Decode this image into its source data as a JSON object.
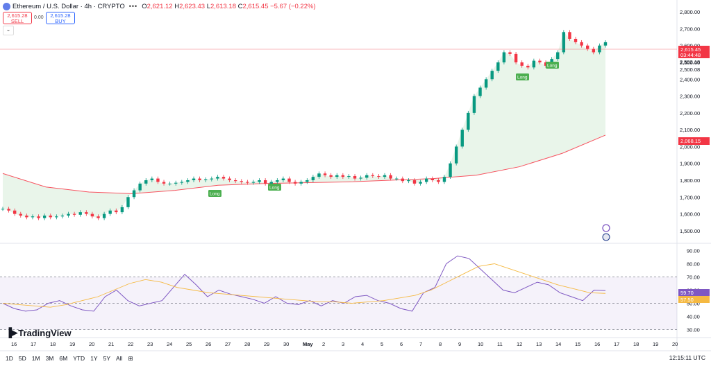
{
  "header": {
    "symbol": "Ethereum / U.S. Dollar · 4h · CRYPTO",
    "o_label": "O",
    "o_value": "2,621.12",
    "h_label": "H",
    "h_value": "2,623.43",
    "l_label": "L",
    "l_value": "2,613.18",
    "c_label": "C",
    "c_value": "2,615.45",
    "change": "−5.67 (−0.22%)"
  },
  "trade": {
    "sell_price": "2,615.28",
    "sell_label": "SELL",
    "spread": "0.00",
    "buy_price": "2,615.28",
    "buy_label": "BUY"
  },
  "price_axis": {
    "ticks": [
      "2,800.00",
      "2,700.00",
      "2,600.00",
      "2,500.00",
      "2,400.00",
      "2,300.00",
      "2,200.00",
      "2,100.00",
      "2,000.00",
      "1,900.00",
      "1,800.00",
      "1,700.00",
      "1,600.00",
      "1,500.00"
    ],
    "current_price": "2,615.45",
    "countdown": "03:44:48",
    "level_1": "2,593.18",
    "level_2": "2,500.08",
    "ma_price": "2,068.15"
  },
  "rsi_axis": {
    "ticks": [
      "90.00",
      "80.00",
      "70.00",
      "60.00",
      "50.00",
      "40.00",
      "30.00"
    ],
    "rsi_value": "59.70",
    "rsi_ma_value": "57.50"
  },
  "time_axis": {
    "labels": [
      "16",
      "17",
      "18",
      "19",
      "20",
      "21",
      "22",
      "23",
      "24",
      "25",
      "26",
      "27",
      "28",
      "29",
      "30",
      "May",
      "2",
      "3",
      "4",
      "5",
      "6",
      "7",
      "8",
      "9",
      "10",
      "11",
      "12",
      "13",
      "14",
      "15",
      "16",
      "17",
      "18",
      "19",
      "20"
    ]
  },
  "signals": [
    "Long",
    "Long",
    "Long",
    "Long"
  ],
  "brand": "TradingView",
  "timeframes": [
    "1D",
    "5D",
    "1M",
    "3M",
    "6M",
    "YTD",
    "1Y",
    "5Y",
    "All"
  ],
  "clock": "12:15:11 UTC",
  "colors": {
    "up": "#089981",
    "down": "#f23645",
    "ma": "#f7525f",
    "rsi": "#7e57c2",
    "rsi_ma": "#f5b942",
    "signal": "#4caf50"
  },
  "chart_data": {
    "type": "candlestick",
    "price_range": [
      1450,
      2850
    ],
    "rsi_range": [
      25,
      95
    ],
    "close_series": [
      1630,
      1620,
      1600,
      1590,
      1580,
      1585,
      1575,
      1590,
      1580,
      1585,
      1590,
      1600,
      1595,
      1610,
      1600,
      1585,
      1575,
      1600,
      1620,
      1610,
      1640,
      1700,
      1740,
      1780,
      1800,
      1810,
      1790,
      1780,
      1780,
      1785,
      1790,
      1800,
      1810,
      1800,
      1805,
      1810,
      1820,
      1810,
      1800,
      1795,
      1790,
      1785,
      1790,
      1800,
      1780,
      1790,
      1800,
      1810,
      1790,
      1780,
      1790,
      1800,
      1820,
      1840,
      1830,
      1820,
      1830,
      1820,
      1825,
      1810,
      1815,
      1830,
      1825,
      1820,
      1830,
      1810,
      1810,
      1795,
      1800,
      1780,
      1790,
      1810,
      1800,
      1790,
      1820,
      1900,
      2000,
      2100,
      2200,
      2300,
      2350,
      2400,
      2450,
      2500,
      2560,
      2550,
      2500,
      2480,
      2470,
      2510,
      2500,
      2480,
      2520,
      2560,
      2680,
      2640,
      2620,
      2600,
      2580,
      2560,
      2600,
      2620
    ],
    "ma_series": [
      1840,
      1760,
      1730,
      1720,
      1740,
      1770,
      1780,
      1785,
      1790,
      1800,
      1810,
      1830,
      1880,
      1960,
      2068
    ],
    "rsi": [
      50,
      46,
      44,
      45,
      50,
      52,
      48,
      45,
      44,
      55,
      60,
      52,
      48,
      50,
      52,
      62,
      72,
      64,
      55,
      60,
      57,
      55,
      53,
      50,
      55,
      50,
      49,
      52,
      48,
      52,
      50,
      55,
      56,
      52,
      50,
      46,
      44,
      58,
      62,
      80,
      86,
      84,
      76,
      68,
      60,
      58,
      62,
      66,
      64,
      58,
      55,
      52,
      60,
      59.7
    ],
    "rsi_ma": [
      50,
      49,
      48,
      47,
      49,
      52,
      55,
      60,
      65,
      68,
      66,
      62,
      60,
      58,
      57,
      56,
      55,
      54,
      53,
      52,
      51,
      51,
      50,
      51,
      52,
      54,
      56,
      60,
      66,
      72,
      78,
      80,
      76,
      72,
      68,
      64,
      61,
      58,
      57.5
    ]
  }
}
